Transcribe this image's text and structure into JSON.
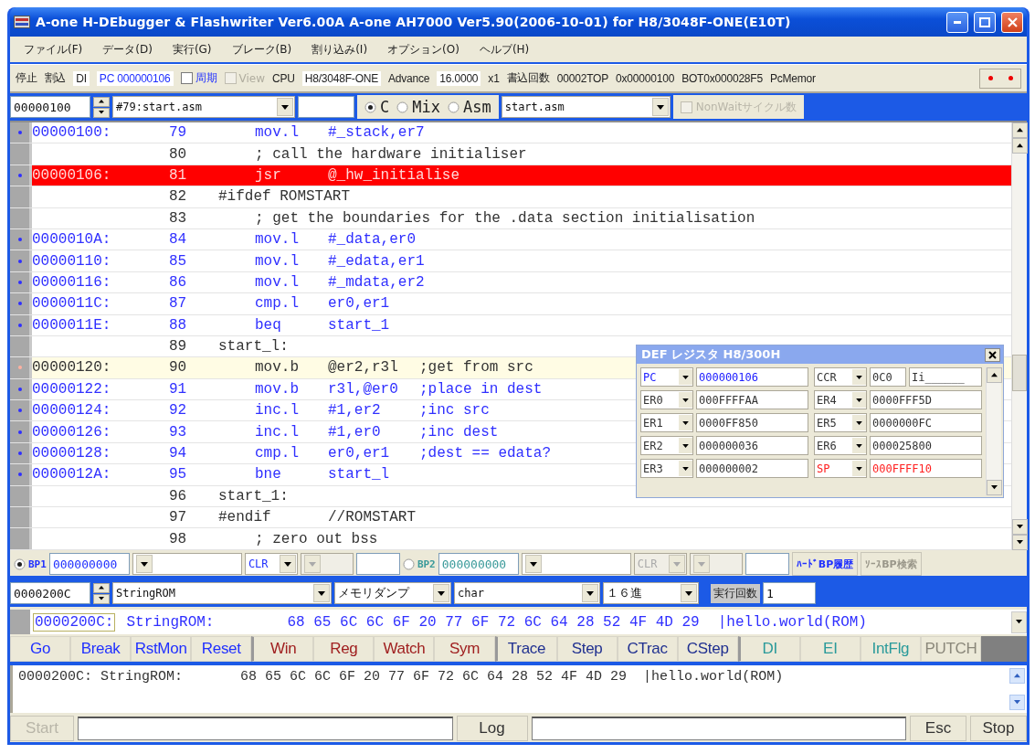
{
  "window": {
    "title": "A-one H-DEbugger & Flashwriter Ver6.00A A-one AH7000 Ver5.90(2006-10-01) for H8/3048F-ONE(E10T)"
  },
  "menu": [
    "ファイル(F)",
    "データ(D)",
    "実行(G)",
    "ブレーク(B)",
    "割り込み(I)",
    "オプション(O)",
    "ヘルプ(H)"
  ],
  "status_bar": [
    {
      "kind": "text",
      "text": "停止"
    },
    {
      "kind": "text",
      "text": "割込"
    },
    {
      "kind": "field",
      "text": "DI"
    },
    {
      "kind": "accent",
      "text": "PC 000000106"
    },
    {
      "kind": "checkbox",
      "text": "周期",
      "checked": false,
      "disabled": false
    },
    {
      "kind": "checkbox",
      "text": "View",
      "checked": false,
      "disabled": true
    },
    {
      "kind": "text",
      "text": "CPU"
    },
    {
      "kind": "field",
      "text": "H8/3048F-ONE"
    },
    {
      "kind": "text",
      "text": "Advance"
    },
    {
      "kind": "field",
      "text": "16.0000"
    },
    {
      "kind": "text",
      "text": "x1"
    },
    {
      "kind": "text",
      "text": "書込回数"
    },
    {
      "kind": "text",
      "text": "00002TOP"
    },
    {
      "kind": "text",
      "text": "0x00000100"
    },
    {
      "kind": "text",
      "text": "BOT0x000028F5"
    },
    {
      "kind": "text",
      "text": "PcMemor"
    }
  ],
  "source_toolbar": {
    "address": "00000100",
    "source_select": "#79:start.asm",
    "modes": [
      {
        "label": "C",
        "selected": true
      },
      {
        "label": "Mix",
        "selected": false
      },
      {
        "label": "Asm",
        "selected": false
      }
    ],
    "file": "start.asm",
    "nonwait": {
      "label": "NonWaitサイクル数",
      "checked": false,
      "disabled": true
    }
  },
  "code": [
    {
      "kind": "instruction",
      "current": false,
      "cursor": false,
      "address": "00000100:",
      "line": "79",
      "mnemonic": "mov.l",
      "operand": "#_stack,er7"
    },
    {
      "kind": "source",
      "current": false,
      "cursor": false,
      "line": "80",
      "statement": "; call the hardware initialiser"
    },
    {
      "kind": "instruction",
      "current": true,
      "cursor": false,
      "address": "00000106:",
      "line": "81",
      "mnemonic": "jsr",
      "operand": "@_hw_initialise"
    },
    {
      "kind": "source",
      "current": false,
      "cursor": false,
      "line": "82",
      "label": "#ifdef ROMSTART"
    },
    {
      "kind": "source",
      "current": false,
      "cursor": false,
      "line": "83",
      "statement": "; get the boundaries for the .data section initialisation"
    },
    {
      "kind": "instruction",
      "current": false,
      "cursor": false,
      "address": "0000010A:",
      "line": "84",
      "mnemonic": "mov.l",
      "operand": "#_data,er0"
    },
    {
      "kind": "instruction",
      "current": false,
      "cursor": false,
      "address": "00000110:",
      "line": "85",
      "mnemonic": "mov.l",
      "operand": "#_edata,er1"
    },
    {
      "kind": "instruction",
      "current": false,
      "cursor": false,
      "address": "00000116:",
      "line": "86",
      "mnemonic": "mov.l",
      "operand": "#_mdata,er2"
    },
    {
      "kind": "instruction",
      "current": false,
      "cursor": false,
      "address": "0000011C:",
      "line": "87",
      "mnemonic": "cmp.l",
      "operand": "er0,er1"
    },
    {
      "kind": "instruction",
      "current": false,
      "cursor": false,
      "address": "0000011E:",
      "line": "88",
      "mnemonic": "beq",
      "operand": "start_1"
    },
    {
      "kind": "source",
      "current": false,
      "cursor": false,
      "line": "89",
      "label": "start_l:"
    },
    {
      "kind": "instruction",
      "current": false,
      "cursor": true,
      "address": "00000120:",
      "line": "90",
      "mnemonic": "mov.b",
      "operand": "@er2,r3l",
      "comment": ";get from src"
    },
    {
      "kind": "instruction",
      "current": false,
      "cursor": false,
      "address": "00000122:",
      "line": "91",
      "mnemonic": "mov.b",
      "operand": "r3l,@er0",
      "comment": ";place in dest"
    },
    {
      "kind": "instruction",
      "current": false,
      "cursor": false,
      "address": "00000124:",
      "line": "92",
      "mnemonic": "inc.l",
      "operand": "#1,er2",
      "comment": ";inc src"
    },
    {
      "kind": "instruction",
      "current": false,
      "cursor": false,
      "address": "00000126:",
      "line": "93",
      "mnemonic": "inc.l",
      "operand": "#1,er0",
      "comment": ";inc dest"
    },
    {
      "kind": "instruction",
      "current": false,
      "cursor": false,
      "address": "00000128:",
      "line": "94",
      "mnemonic": "cmp.l",
      "operand": "er0,er1",
      "comment": ";dest == edata?"
    },
    {
      "kind": "instruction",
      "current": false,
      "cursor": false,
      "address": "0000012A:",
      "line": "95",
      "mnemonic": "bne",
      "operand": "start_l"
    },
    {
      "kind": "source",
      "current": false,
      "cursor": false,
      "line": "96",
      "label": "start_1:"
    },
    {
      "kind": "source",
      "current": false,
      "cursor": false,
      "line": "97",
      "label": "#endif",
      "operand": "//ROMSTART"
    },
    {
      "kind": "source",
      "current": false,
      "cursor": false,
      "line": "98",
      "statement": "; zero out bss"
    }
  ],
  "register_window": {
    "title": "DEF レジスタ H8/300H",
    "registers": [
      {
        "name": "PC",
        "value": "000000106",
        "color": "#2020ff"
      },
      {
        "name": "CCR",
        "value": "0C0",
        "flags": "Ii______",
        "color": "#333333"
      },
      {
        "name": "ER0",
        "value": "000FFFFAA",
        "color": "#333333"
      },
      {
        "name": "ER4",
        "value": "0000FFF5D",
        "color": "#333333"
      },
      {
        "name": "ER1",
        "value": "0000FF850",
        "color": "#333333"
      },
      {
        "name": "ER5",
        "value": "0000000FC",
        "color": "#333333"
      },
      {
        "name": "ER2",
        "value": "000000036",
        "color": "#333333"
      },
      {
        "name": "ER6",
        "value": "000025800",
        "color": "#333333"
      },
      {
        "name": "ER3",
        "value": "000000002",
        "color": "#333333"
      },
      {
        "name": "SP",
        "value": "000FFFF10",
        "color": "#ff2020"
      }
    ]
  },
  "breakpoints": [
    {
      "label": "BP1",
      "selected": true,
      "address": "000000000",
      "action": "CLR"
    },
    {
      "label": "BP2",
      "selected": false,
      "address": "000000000",
      "action": "CLR"
    }
  ],
  "bp_buttons": [
    {
      "label": "ﾊｰﾄﾞBP履歴",
      "disabled": false
    },
    {
      "label": "ｿｰｽBP検索",
      "disabled": true
    }
  ],
  "memory_toolbar": {
    "address": "0000200C",
    "symbol": "StringROM",
    "mode": "メモリダンプ",
    "type": "char",
    "radix": "１６進",
    "count_label": "実行回数",
    "count": "1"
  },
  "memory_row": {
    "address": "0000200C:",
    "symbol": "StringROM:",
    "bytes": "68 65 6C 6C 6F 20 77 6F 72 6C 64 28 52 4F 4D 29",
    "ascii": "|hello.world(ROM)"
  },
  "command_buttons": [
    {
      "label": "Go",
      "kind": "run",
      "disabled": false
    },
    {
      "label": "Break",
      "kind": "run",
      "disabled": false
    },
    {
      "label": "RstMon",
      "kind": "run",
      "disabled": false
    },
    {
      "label": "Reset",
      "kind": "run",
      "disabled": false
    },
    {
      "label": "Win",
      "kind": "view",
      "disabled": false
    },
    {
      "label": "Reg",
      "kind": "view",
      "disabled": false
    },
    {
      "label": "Watch",
      "kind": "view",
      "disabled": false
    },
    {
      "label": "Sym",
      "kind": "view",
      "disabled": false
    },
    {
      "label": "Trace",
      "kind": "step",
      "disabled": false
    },
    {
      "label": "Step",
      "kind": "step",
      "disabled": false
    },
    {
      "label": "CTrac",
      "kind": "step",
      "disabled": false
    },
    {
      "label": "CStep",
      "kind": "step",
      "disabled": false
    },
    {
      "label": "DI",
      "kind": "interrupt",
      "disabled": false
    },
    {
      "label": "EI",
      "kind": "interrupt",
      "disabled": false
    },
    {
      "label": "IntFlg",
      "kind": "interrupt",
      "disabled": false
    },
    {
      "label": "PUTCH",
      "kind": "interrupt",
      "disabled": true
    }
  ],
  "output": [
    "0000200C: StringROM:       68 65 6C 6C 6F 20 77 6F 72 6C 64 28 52 4F 4D 29  |hello.world(ROM)"
  ],
  "command_bar": {
    "start": {
      "label": "Start",
      "disabled": true
    },
    "log": "Log",
    "esc": "Esc",
    "stop": "Stop"
  }
}
